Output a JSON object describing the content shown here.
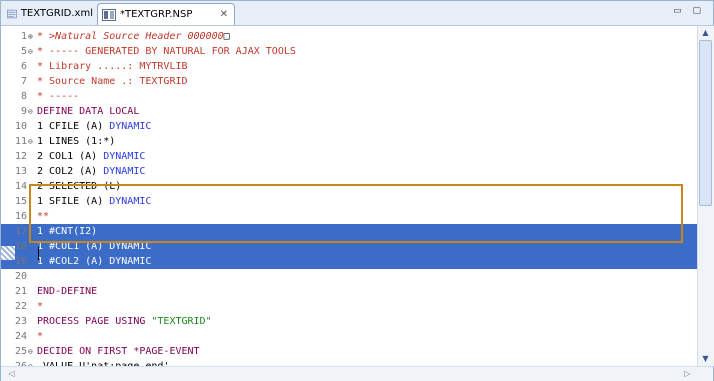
{
  "tabs": [
    {
      "label": "TEXTGRID.xml",
      "icon": "xml-file-icon",
      "active": false
    },
    {
      "label": "*TEXTGRP.NSP",
      "icon": "nsp-file-icon",
      "active": true,
      "close": "✕"
    }
  ],
  "window_controls": "▭ ▢",
  "lines": [
    {
      "num": "1",
      "fold": "⊕",
      "segments": [
        {
          "t": "* >Natural Source Header 000000",
          "c": "cm",
          "italic": true
        },
        {
          "t": "□",
          "c": "bk"
        }
      ]
    },
    {
      "num": "5",
      "fold": "⊖",
      "segments": [
        {
          "t": "* ----- GENERATED BY NATURAL FOR AJAX TOOLS",
          "c": "cm"
        }
      ]
    },
    {
      "num": "6",
      "fold": "",
      "segments": [
        {
          "t": "* Library .....: MYTRVLIB",
          "c": "cm"
        }
      ]
    },
    {
      "num": "7",
      "fold": "",
      "segments": [
        {
          "t": "* Source Name .: TEXTGRID",
          "c": "cm"
        }
      ]
    },
    {
      "num": "8",
      "fold": "",
      "segments": [
        {
          "t": "* -----",
          "c": "cm"
        }
      ]
    },
    {
      "num": "9",
      "fold": "⊖",
      "segments": [
        {
          "t": "DEFINE DATA LOCAL",
          "c": "kw"
        }
      ]
    },
    {
      "num": "10",
      "fold": "",
      "segments": [
        {
          "t": "1 CFILE (A) ",
          "c": "bk"
        },
        {
          "t": "DYNAMIC",
          "c": "bl"
        }
      ]
    },
    {
      "num": "11",
      "fold": "⊖",
      "segments": [
        {
          "t": "1 LINES (1:*)",
          "c": "bk"
        }
      ]
    },
    {
      "num": "12",
      "fold": "",
      "segments": [
        {
          "t": "2 COL1 (A) ",
          "c": "bk"
        },
        {
          "t": "DYNAMIC",
          "c": "bl"
        }
      ]
    },
    {
      "num": "13",
      "fold": "",
      "segments": [
        {
          "t": "2 COL2 (A) ",
          "c": "bk"
        },
        {
          "t": "DYNAMIC",
          "c": "bl"
        }
      ]
    },
    {
      "num": "14",
      "fold": "",
      "segments": [
        {
          "t": "2 SELECTED (L)",
          "c": "bk"
        }
      ]
    },
    {
      "num": "15",
      "fold": "",
      "segments": [
        {
          "t": "1 SFILE (A) ",
          "c": "bk"
        },
        {
          "t": "DYNAMIC",
          "c": "bl"
        }
      ]
    },
    {
      "num": "16",
      "fold": "",
      "segments": [
        {
          "t": "**",
          "c": "cm"
        }
      ]
    },
    {
      "num": "17",
      "fold": "",
      "selected": true,
      "segments": [
        {
          "t": "1 #CNT(I2)",
          "c": "bk"
        }
      ]
    },
    {
      "num": "18",
      "fold": "",
      "selected": true,
      "segments": [
        {
          "t": "1 #COL1 (A) DYNAMIC",
          "c": "bk"
        }
      ]
    },
    {
      "num": "19",
      "fold": "",
      "selected": true,
      "segments": [
        {
          "t": "1 #COL2 (A) DYNAMIC",
          "c": "bk"
        }
      ]
    },
    {
      "num": "20",
      "fold": "",
      "segments": [
        {
          "t": "",
          "c": "bk"
        }
      ]
    },
    {
      "num": "21",
      "fold": "",
      "segments": [
        {
          "t": "END-DEFINE",
          "c": "kw"
        }
      ]
    },
    {
      "num": "22",
      "fold": "",
      "segments": [
        {
          "t": "*",
          "c": "cm"
        }
      ]
    },
    {
      "num": "23",
      "fold": "",
      "segments": [
        {
          "t": "PROCESS PAGE USING ",
          "c": "kw"
        },
        {
          "t": "\"TEXTGRID\"",
          "c": "gn"
        }
      ]
    },
    {
      "num": "24",
      "fold": "",
      "segments": [
        {
          "t": "*",
          "c": "cm"
        }
      ]
    },
    {
      "num": "25",
      "fold": "⊖",
      "segments": [
        {
          "t": "DECIDE ON FIRST *PAGE-EVENT",
          "c": "kw"
        }
      ]
    },
    {
      "num": "26",
      "fold": "⊖",
      "segments": [
        {
          "t": " VALUE U'nat:page.end'",
          "c": "bk"
        }
      ]
    }
  ],
  "scroll": {
    "up": "▲",
    "down": "▼",
    "left": "◁",
    "right": "▷"
  },
  "colors": {
    "selection": "#3b6cc7",
    "highlight_box": "#c8861d",
    "comment": "#c0392b",
    "keyword": "#7f0055",
    "literal_blue": "#2a3be0",
    "string_green": "#1a8a1a"
  }
}
